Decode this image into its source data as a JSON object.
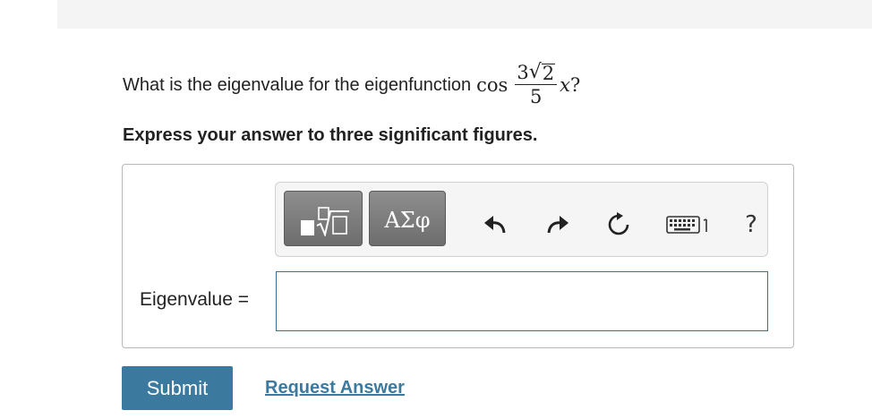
{
  "question": {
    "prefix": "What is the eigenvalue for the eigenfunction",
    "func": "cos",
    "coef": "3",
    "radicand": "2",
    "denominator": "5",
    "variable": "x",
    "suffix": "?"
  },
  "instruction": "Express your answer to three significant figures.",
  "toolbar": {
    "templates_icon": "templates-sqrt-icon",
    "greek_label": "ΑΣφ",
    "undo_icon": "undo-arrow-icon",
    "redo_icon": "redo-arrow-icon",
    "reset_icon": "reset-icon",
    "keyboard_icon": "keyboard-icon",
    "help_label": "?"
  },
  "answer": {
    "label": "Eigenvalue =",
    "value": ""
  },
  "actions": {
    "submit_label": "Submit",
    "request_label": "Request Answer"
  },
  "colors": {
    "accent": "#3b7a9e",
    "toolbar_button": "#7a7a7a"
  }
}
